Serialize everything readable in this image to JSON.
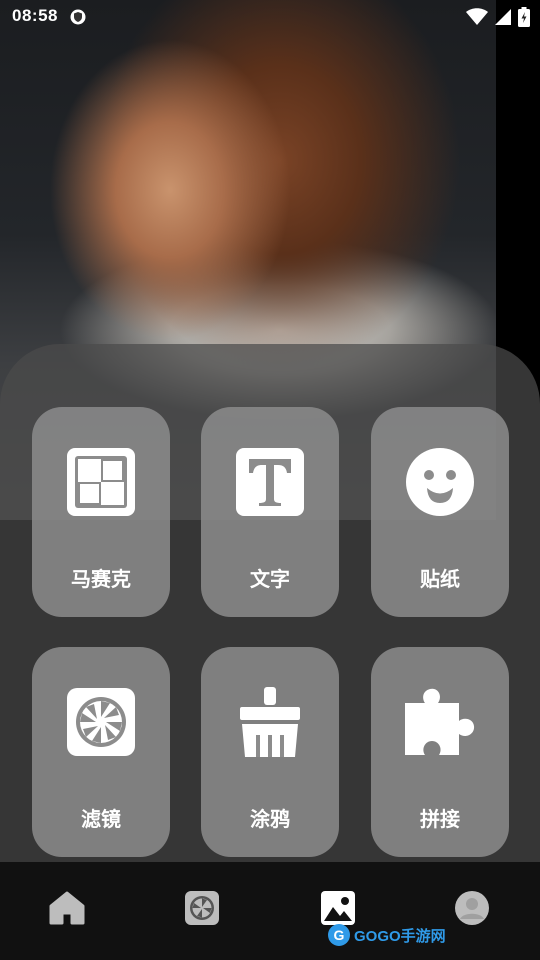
{
  "status_bar": {
    "time": "08:58",
    "icons": [
      "shield-icon",
      "wifi-icon",
      "signal-icon",
      "battery-icon"
    ]
  },
  "tools": [
    {
      "label": "马赛克",
      "icon": "mosaic-icon"
    },
    {
      "label": "文字",
      "icon": "text-icon"
    },
    {
      "label": "贴纸",
      "icon": "sticker-icon"
    },
    {
      "label": "滤镜",
      "icon": "filter-aperture-icon"
    },
    {
      "label": "涂鸦",
      "icon": "brush-icon"
    },
    {
      "label": "拼接",
      "icon": "puzzle-icon"
    }
  ],
  "bottom_nav": {
    "items": [
      {
        "icon": "home-icon",
        "active": false
      },
      {
        "icon": "aperture-icon",
        "active": false
      },
      {
        "icon": "gallery-icon",
        "active": true
      },
      {
        "icon": "profile-icon",
        "active": false
      }
    ]
  },
  "watermark": {
    "logo_letter": "G",
    "text": "GOGO手游网"
  },
  "colors": {
    "panel": "#4b4b4b",
    "card": "#8c8c8c",
    "nav_bg": "#111111",
    "watermark": "#2f9ae8"
  }
}
